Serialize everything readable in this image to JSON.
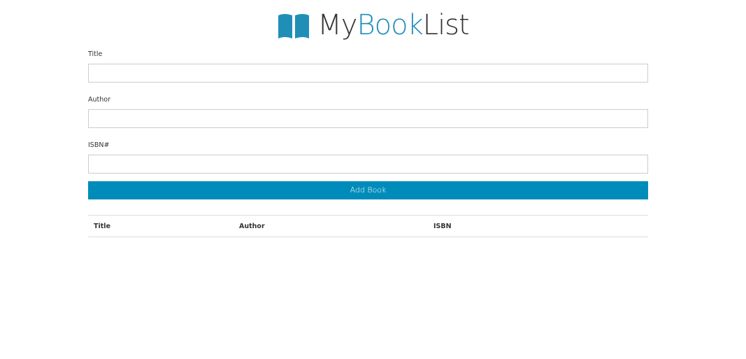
{
  "brand": {
    "name_part1": "My",
    "name_part2": "Book",
    "name_part3": "List",
    "icon": "open-book-icon",
    "accent_color": "#1f8fb8"
  },
  "form": {
    "title_label": "Title",
    "title_value": "",
    "author_label": "Author",
    "author_value": "",
    "isbn_label": "ISBN#",
    "isbn_value": "",
    "submit_label": "Add Book",
    "button_color": "#008cba"
  },
  "table": {
    "columns": [
      "Title",
      "Author",
      "ISBN"
    ],
    "rows": []
  }
}
